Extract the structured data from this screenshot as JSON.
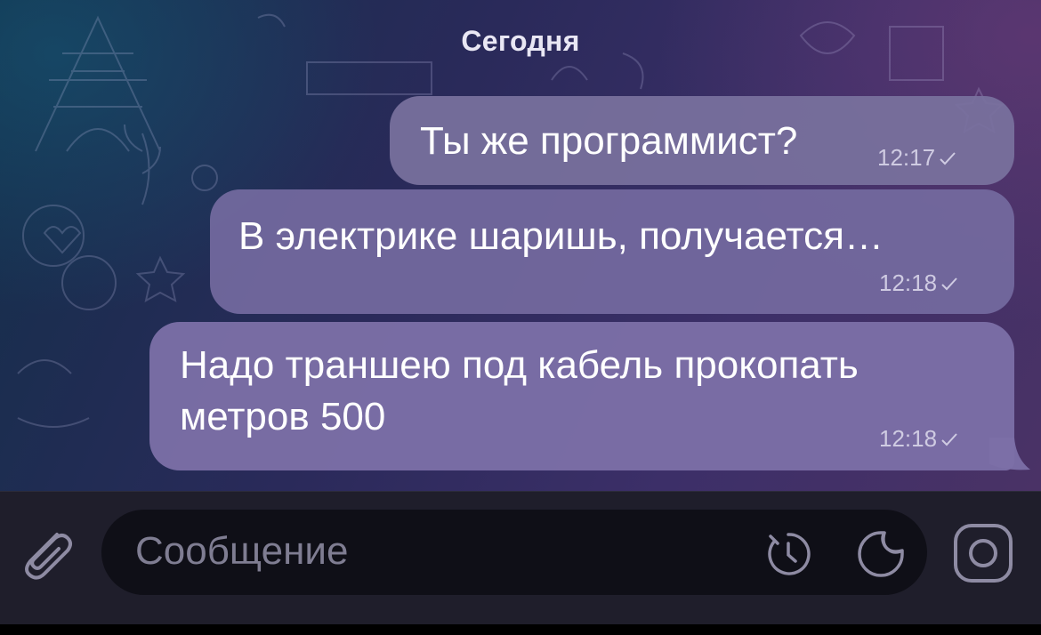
{
  "chat": {
    "date_label": "Сегодня",
    "messages": [
      {
        "text": "Ты же программист?",
        "time": "12:17",
        "status": "sent-check-icon"
      },
      {
        "text": "В электрике шаришь, получается…",
        "time": "12:18",
        "status": "sent-check-icon"
      },
      {
        "text": "Надо траншею под кабель прокопать метров 500",
        "time": "12:18",
        "status": "sent-check-icon"
      }
    ]
  },
  "composer": {
    "placeholder": "Сообщение",
    "icons": {
      "attach": "paperclip-icon",
      "timer": "timer-icon",
      "sticker": "sticker-icon",
      "camera": "camera-icon"
    }
  },
  "colors": {
    "bubble": "#7a729e",
    "composer_bg": "#1f1e2b",
    "input_bg": "#0f0f17",
    "placeholder": "#7f7d92",
    "icon": "#8e8ba3"
  }
}
